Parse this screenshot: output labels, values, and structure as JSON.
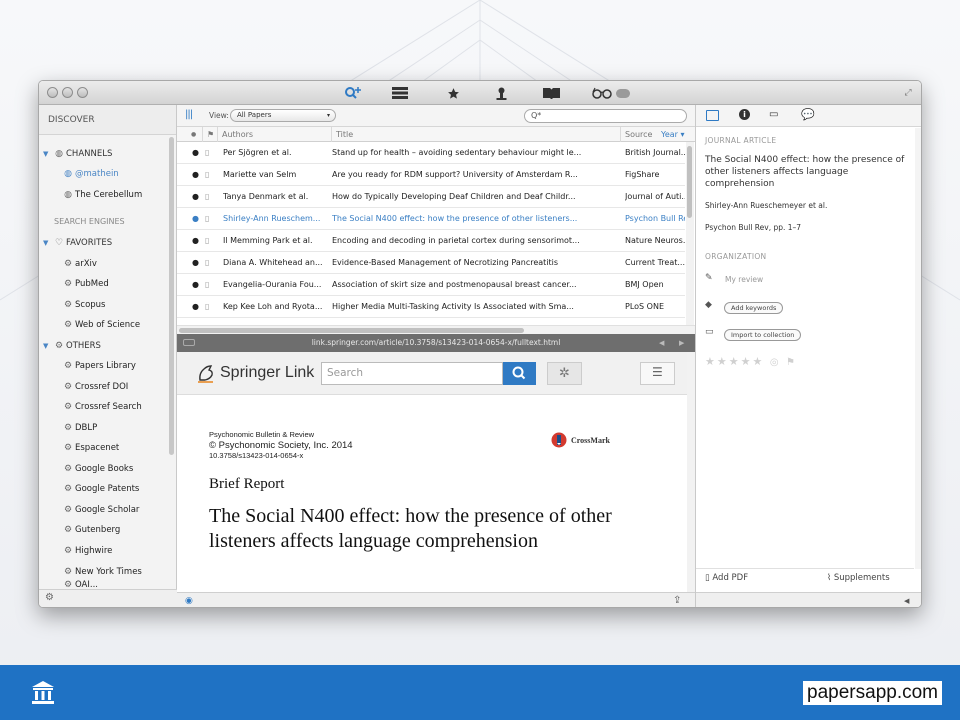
{
  "toolbar": {
    "icons": [
      "search-add-icon",
      "library-icon",
      "star-icon",
      "person-icon",
      "book-icon",
      "glasses-icon"
    ]
  },
  "sidebar": {
    "header": "DISCOVER",
    "sections": {
      "channels": "CHANNELS",
      "search_engines": "SEARCH ENGINES",
      "favorites": "FAVORITES",
      "others": "OTHERS"
    },
    "channels": [
      "@mathein",
      "The Cerebellum"
    ],
    "favorites": [
      "arXiv",
      "PubMed",
      "Scopus",
      "Web of Science"
    ],
    "others": [
      "Papers Library",
      "Crossref DOI",
      "Crossref Search",
      "DBLP",
      "Espacenet",
      "Google Books",
      "Google Patents",
      "Google Scholar",
      "Gutenberg",
      "Highwire",
      "New York Times",
      "OAI..."
    ]
  },
  "center": {
    "view_label": "View:",
    "view_value": "All Papers",
    "search_placeholder": "Q*",
    "columns": {
      "authors": "Authors",
      "title": "Title",
      "source": "Source",
      "year": "Year"
    },
    "rows": [
      {
        "authors": "Per Sjögren et al.",
        "title": "Stand up for health – avoiding sedentary behaviour might le...",
        "source": "British Journal...",
        "selected": false
      },
      {
        "authors": "Mariette van Selm",
        "title": "Are you ready for RDM support? University of Amsterdam R...",
        "source": "FigShare",
        "selected": false
      },
      {
        "authors": "Tanya Denmark et al.",
        "title": "How do Typically Developing Deaf Children and Deaf Childr...",
        "source": "Journal of Auti...",
        "selected": false
      },
      {
        "authors": "Shirley-Ann Rueschem...",
        "title": "The Social N400 effect: how the presence of other listeners...",
        "source": "Psychon Bull Rev",
        "selected": true
      },
      {
        "authors": "Il Memming Park et al.",
        "title": "Encoding and decoding in parietal cortex during sensorimot...",
        "source": "Nature Neuros...",
        "selected": false
      },
      {
        "authors": "Diana A. Whitehead an...",
        "title": "Evidence-Based Management of Necrotizing Pancreatitis",
        "source": "Current Treat...",
        "selected": false
      },
      {
        "authors": "Evangelia-Ourania Fou...",
        "title": "Association of skirt size and postmenopausal breast cancer...",
        "source": "BMJ Open",
        "selected": false
      },
      {
        "authors": "Kep Kee Loh and Ryota...",
        "title": "Higher Media Multi-Tasking Activity Is Associated with Sma...",
        "source": "PLoS ONE",
        "selected": false
      }
    ],
    "url": "link.springer.com/article/10.3758/s13423-014-0654-x/fulltext.html"
  },
  "springer": {
    "logo": "Springer Link",
    "search_placeholder": "Search",
    "journal": "Psychonomic Bulletin & Review",
    "copyright": "© Psychonomic Society, Inc. 2014",
    "doi": "10.3758/s13423-014-0654-x",
    "crossmark": "CrossMark",
    "type": "Brief Report",
    "title": "The Social N400 effect: how the presence of other listeners affects language comprehension"
  },
  "right": {
    "section_type": "JOURNAL ARTICLE",
    "title": "The Social N400 effect: how the presence of other listeners affects language comprehension",
    "authors": "Shirley-Ann Rueschemeyer et al.",
    "citation": "Psychon Bull Rev, pp. 1–7",
    "organization": "ORGANIZATION",
    "my_review": "My review",
    "add_keywords": "Add keywords",
    "import_collection": "Import to collection",
    "add_pdf": "Add PDF",
    "supplements": "Supplements"
  },
  "footer": {
    "url": "papersapp.com"
  },
  "colors": {
    "accent": "#3a7fc4",
    "bottom_bar": "#1f72c4",
    "springer_button": "#2f7ac4"
  }
}
